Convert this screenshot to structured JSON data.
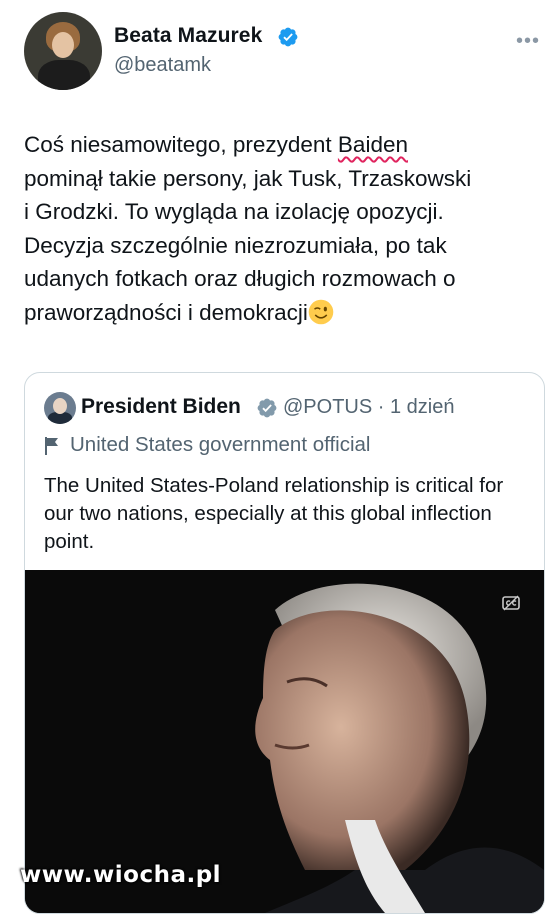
{
  "tweet": {
    "author_name": "Beata Mazurek",
    "author_handle": "@beatamk",
    "more_label": "•••",
    "text_lines": [
      [
        "Coś niesamowitego, prezydent ",
        "Baiden",
        ""
      ],
      "pominął takie persony, jak Tusk, Trzaskowski",
      "i Grodzki. To wygląda na izolację opozycji.",
      "Decyzja szczególnie niezrozumiała, po tak",
      "udanych fotkach oraz długich rozmowach o",
      "praworządności i demokracji"
    ],
    "emoji": "winking-face-emoji"
  },
  "quoted_tweet": {
    "author_name": "President Biden",
    "author_handle": "@POTUS",
    "separator": "·",
    "time": "1 dzień",
    "affiliation": "United States government official",
    "text": "The United States-Poland relationship is critical for our two nations, especially at this global inflection point."
  },
  "watermark": "www.wiocha.pl",
  "colors": {
    "verified": "#1d9bf0",
    "secondary_text": "#536471",
    "wavy_underline": "#e0245e"
  }
}
